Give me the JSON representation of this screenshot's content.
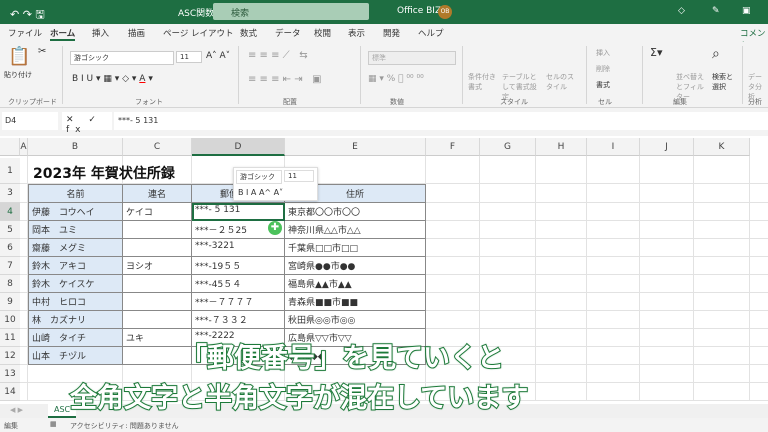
{
  "titlebar": {
    "filename": "ASC関数.xlsx ⌄",
    "search": "検索",
    "user": "Office BIZ",
    "avatar": "OB"
  },
  "tabs": [
    "ファイル",
    "ホーム",
    "挿入",
    "描画",
    "ページ レイアウト",
    "数式",
    "データ",
    "校閲",
    "表示",
    "開発",
    "ヘルプ"
  ],
  "comment_button": "コメント",
  "ribbon": {
    "groups": [
      "クリップボード",
      "フォント",
      "配置",
      "数値",
      "スタイル",
      "セル",
      "編集",
      "分析"
    ],
    "paste": "貼り付け",
    "font": "游ゴシック",
    "size": "11",
    "number_format": "標準",
    "cond_format": "条件付き書式",
    "table_format": "テーブルとして書式設定",
    "cell_style": "セルのスタイル",
    "insert": "挿入",
    "delete": "削除",
    "format": "書式",
    "sort": "並べ替えとフィルター",
    "find": "検索と選択",
    "analyze": "データ分析"
  },
  "formula": {
    "namebox": "D4",
    "fx": "✕ ✓ fx",
    "value": "***- 5 131"
  },
  "columns": [
    "A",
    "B",
    "C",
    "D",
    "E",
    "F",
    "G",
    "H",
    "I",
    "J",
    "K"
  ],
  "rows": [
    "1",
    "3",
    "4",
    "5",
    "6",
    "7",
    "8",
    "9",
    "10",
    "11",
    "12",
    "13",
    "14"
  ],
  "sheet": {
    "title": "2023年 年賀状住所録",
    "headers": [
      "名前",
      "連名",
      "郵便番号",
      "住所"
    ],
    "data": [
      [
        "伊藤　コウヘイ",
        "ケイコ",
        "***- 5 131",
        "東京都〇〇市〇〇"
      ],
      [
        "岡本　ユミ",
        "",
        "***－２５25",
        "神奈川県△△市△△"
      ],
      [
        "齋藤　メグミ",
        "",
        "***-3221",
        "千葉県□□市□□"
      ],
      [
        "鈴木　アキコ",
        "ヨシオ",
        "***-19５５",
        "宮崎県●●市●●"
      ],
      [
        "鈴木　ケイスケ",
        "",
        "***-45５４",
        "福島県▲▲市▲▲"
      ],
      [
        "中村　ヒロコ",
        "",
        "***－７７７７",
        "青森県■■市■■"
      ],
      [
        "林　カズナリ",
        "",
        "***-７３３２",
        "秋田県◎◎市◎◎"
      ],
      [
        "山崎　タイチ",
        "ユキ",
        "***-2222",
        "広島県▽▽市▽▽"
      ],
      [
        "山本　チヅル",
        "",
        "",
        "◆◆市◆◆"
      ]
    ]
  },
  "mini_toolbar": {
    "font": "游ゴシック",
    "size": "11",
    "buttons": "B I A A^ A˅"
  },
  "caption": {
    "line1": "「郵便番号」を見ていくと",
    "line2": "全角文字と半角文字が混在しています"
  },
  "sheet_tab": "ASC",
  "status": {
    "mode": "編集",
    "accessibility": "アクセシビリティ: 問題ありません"
  }
}
